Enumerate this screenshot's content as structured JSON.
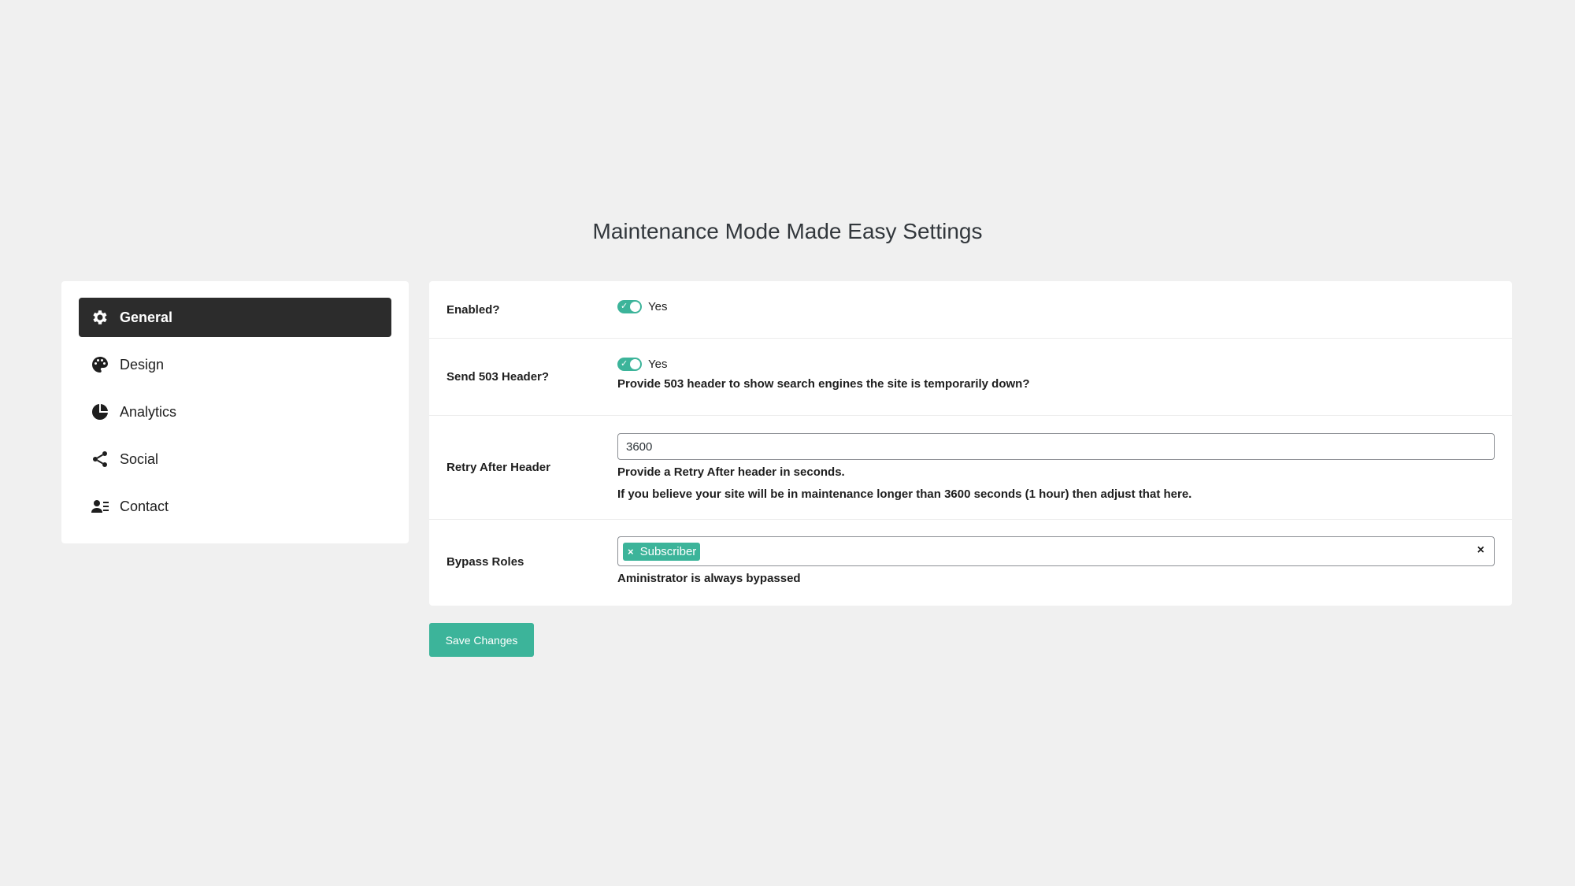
{
  "page": {
    "title": "Maintenance Mode Made Easy Settings"
  },
  "sidebar": {
    "items": [
      {
        "label": "General",
        "icon": "gear-icon",
        "active": true
      },
      {
        "label": "Design",
        "icon": "palette-icon",
        "active": false
      },
      {
        "label": "Analytics",
        "icon": "pie-chart-icon",
        "active": false
      },
      {
        "label": "Social",
        "icon": "share-icon",
        "active": false
      },
      {
        "label": "Contact",
        "icon": "contact-card-icon",
        "active": false
      }
    ]
  },
  "settings": {
    "enabled": {
      "label": "Enabled?",
      "toggle_on": true,
      "toggle_text": "Yes"
    },
    "send503": {
      "label": "Send 503 Header?",
      "toggle_on": true,
      "toggle_text": "Yes",
      "help": "Provide 503 header to show search engines the site is temporarily down?"
    },
    "retry": {
      "label": "Retry After Header",
      "value": "3600",
      "help1": "Provide a Retry After header in seconds.",
      "help2": "If you believe your site will be in maintenance longer than 3600 seconds (1 hour) then adjust that here."
    },
    "bypass": {
      "label": "Bypass Roles",
      "selected": [
        "Subscriber"
      ],
      "tag_remove": "×",
      "clear": "×",
      "help": "Aministrator is always bypassed"
    }
  },
  "actions": {
    "save_label": "Save Changes"
  },
  "colors": {
    "accent": "#3cb49a",
    "active_nav": "#2c2c2c",
    "background": "#f0f0f0"
  }
}
